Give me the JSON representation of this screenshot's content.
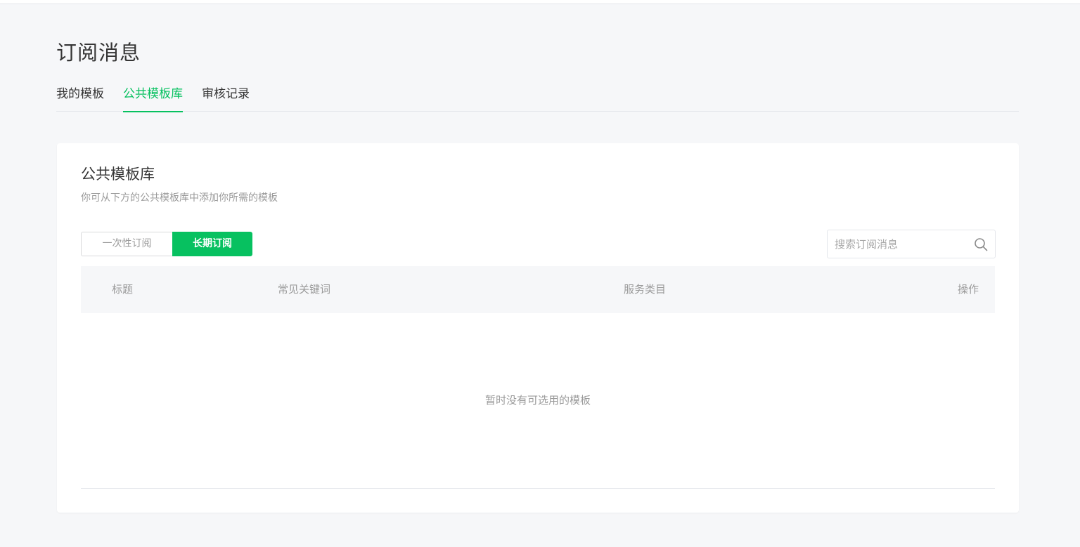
{
  "page": {
    "title": "订阅消息"
  },
  "tabs": [
    {
      "label": "我的模板",
      "active": false
    },
    {
      "label": "公共模板库",
      "active": true
    },
    {
      "label": "审核记录",
      "active": false
    }
  ],
  "card": {
    "title": "公共模板库",
    "description": "你可从下方的公共模板库中添加你所需的模板"
  },
  "segment": {
    "options": [
      {
        "label": "一次性订阅",
        "selected": false
      },
      {
        "label": "长期订阅",
        "selected": true
      }
    ]
  },
  "search": {
    "placeholder": "搜索订阅消息",
    "value": "",
    "icon": "search-icon"
  },
  "table": {
    "columns": [
      "标题",
      "常见关键词",
      "服务类目",
      "操作"
    ],
    "rows": [],
    "empty_text": "暂时没有可选用的模板"
  },
  "colors": {
    "accent": "#07c160",
    "background": "#f6f7f9",
    "muted_text": "#9a9a9a"
  }
}
